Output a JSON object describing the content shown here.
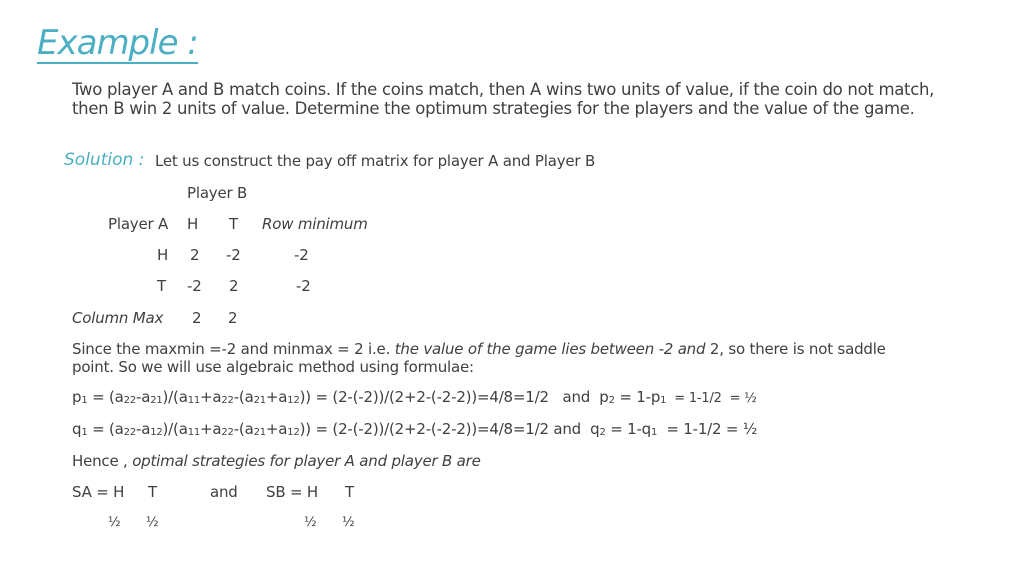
{
  "title": "Example :",
  "problem": "Two player A and B match coins. If the coins match, then A wins two units of value, if the coin do not match, then B win 2 units of value. Determine the optimum strategies for the players and the value of the game.",
  "solution": {
    "label": "Solution :",
    "intro": "Let us construct the pay off matrix for player A and Player B"
  },
  "matrix": {
    "player_b_label": "Player B",
    "player_a_label": "Player A",
    "col_headers": [
      "H",
      "T"
    ],
    "row_min_header": "Row minimum",
    "rows": [
      {
        "label": "H",
        "values": [
          "2",
          "-2"
        ],
        "row_min": "-2"
      },
      {
        "label": "T",
        "values": [
          "-2",
          "2"
        ],
        "row_min": "-2"
      }
    ],
    "col_max_label": "Column Max",
    "col_max": [
      "2",
      "2"
    ]
  },
  "since": {
    "part1": "Since the maxmin =-2 and minmax = 2 i.e. ",
    "italic": "the value of the game lies between -2 and ",
    "part2": "2, so there is not saddle",
    "line2": "point. So we will use algebraic method using formulae:"
  },
  "p_formula": {
    "lhs": "p",
    "lhs_sub": "1",
    "eq": " = (a",
    "t1": "22",
    "t2": "-a",
    "t3": "21",
    "t4": ")/(a",
    "t5": "11",
    "t6": "+a",
    "t7": "22",
    "t8": "-(a",
    "t9": "21",
    "t10": "+a",
    "t11": "12",
    "rest": ")) = (2-(-2))/(2+2-(-2-2))=4/8=1/2   and  p",
    "p2_sub": "2",
    "mid": " = 1-p",
    "p1_sub": "1",
    "tail": "  = 1-1/2  = ½"
  },
  "q_formula": {
    "lhs": "q",
    "lhs_sub": "1",
    "eq": " = (a",
    "t1": "22",
    "t2": "-a",
    "t3": "12",
    "t4": ")/(a",
    "t5": "11",
    "t6": "+a",
    "t7": "22",
    "t8": "-(a",
    "t9": "21",
    "t10": "+a",
    "t11": "12",
    "rest": ")) = (2-(-2))/(2+2-(-2-2))=4/8=1/2 and  q",
    "q2_sub": "2",
    "mid": " = 1-q",
    "q1_sub": "1",
    "tail": "  = 1-1/2 = ½"
  },
  "hence": {
    "prefix": "Hence , ",
    "italic": "optimal strategies for player A and player B are"
  },
  "strategies": {
    "sa_label": "SA = H",
    "sa_t": "T",
    "and": "and",
    "sb_label": "SB = H",
    "sb_t": "T",
    "sa_probs": [
      "½",
      "½"
    ],
    "sb_probs": [
      "½",
      "½"
    ]
  },
  "colors": {
    "accent": "#4aafc2",
    "text": "#404040"
  }
}
